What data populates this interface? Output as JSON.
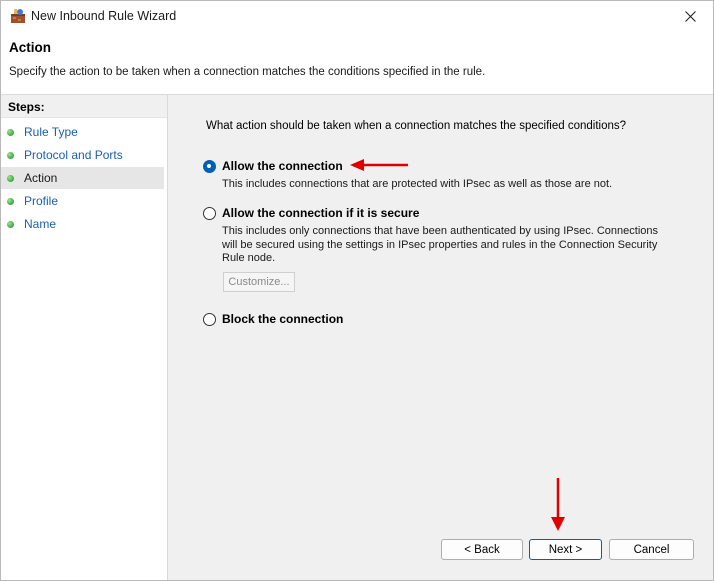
{
  "window": {
    "title": "New Inbound Rule Wizard",
    "app_icon": "firewall-wizard-icon",
    "close_icon": "close-icon"
  },
  "header": {
    "title": "Action",
    "description": "Specify the action to be taken when a connection matches the conditions specified in the rule."
  },
  "steps": {
    "heading": "Steps:",
    "items": [
      {
        "label": "Rule Type",
        "current": false
      },
      {
        "label": "Protocol and Ports",
        "current": false
      },
      {
        "label": "Action",
        "current": true
      },
      {
        "label": "Profile",
        "current": false
      },
      {
        "label": "Name",
        "current": false
      }
    ]
  },
  "main": {
    "question": "What action should be taken when a connection matches the specified conditions?",
    "options": [
      {
        "label": "Allow the connection",
        "description": "This includes connections that are protected with IPsec as well as those are not.",
        "selected": true
      },
      {
        "label": "Allow the connection if it is secure",
        "description_lines": [
          "This includes only connections that have been authenticated by using IPsec.  Connections",
          "will be secured using the settings in IPsec properties and rules in the Connection Security",
          "Rule node."
        ],
        "selected": false,
        "customize_label": "Customize..."
      },
      {
        "label": "Block the connection",
        "selected": false
      }
    ]
  },
  "buttons": {
    "back": "< Back",
    "next": "Next >",
    "cancel": "Cancel"
  },
  "colors": {
    "accent": "#005fb8",
    "annotation_arrow": "#e00000",
    "step_link": "#1a5fb4"
  }
}
